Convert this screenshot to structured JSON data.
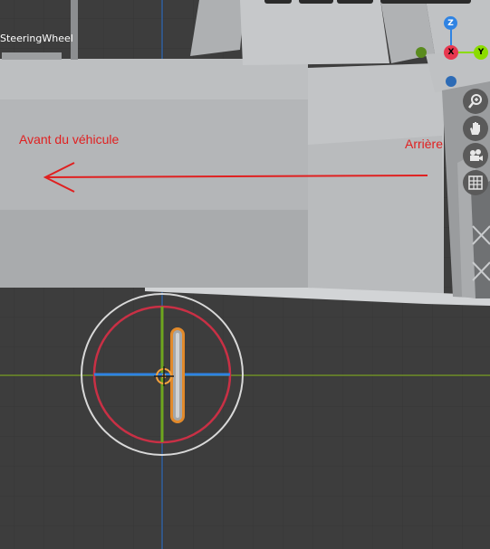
{
  "viewport": {
    "object_name": "SteeringWheel",
    "annotations": {
      "front_label": "Avant du véhicule",
      "rear_label": "Arrière"
    }
  },
  "gizmo": {
    "z_label": "Z",
    "x_label": "X",
    "y_label": "Y",
    "colors": {
      "x": "#e8384f",
      "y": "#8bdc00",
      "z": "#2f83e3",
      "neg_y": "#5a8b1e",
      "neg_z": "#2d6bb5"
    }
  },
  "nav_controls": [
    "zoom-icon",
    "hand-pan-icon",
    "camera-icon",
    "grid-view-icon"
  ],
  "colors": {
    "background": "#3d3d3d",
    "grid": "#363636",
    "axis_x": "#6e8f27",
    "axis_y": "#2e5f9e",
    "annotation": "#e02020",
    "selection": "#f5a23c",
    "transform_circle": "#c93045"
  }
}
